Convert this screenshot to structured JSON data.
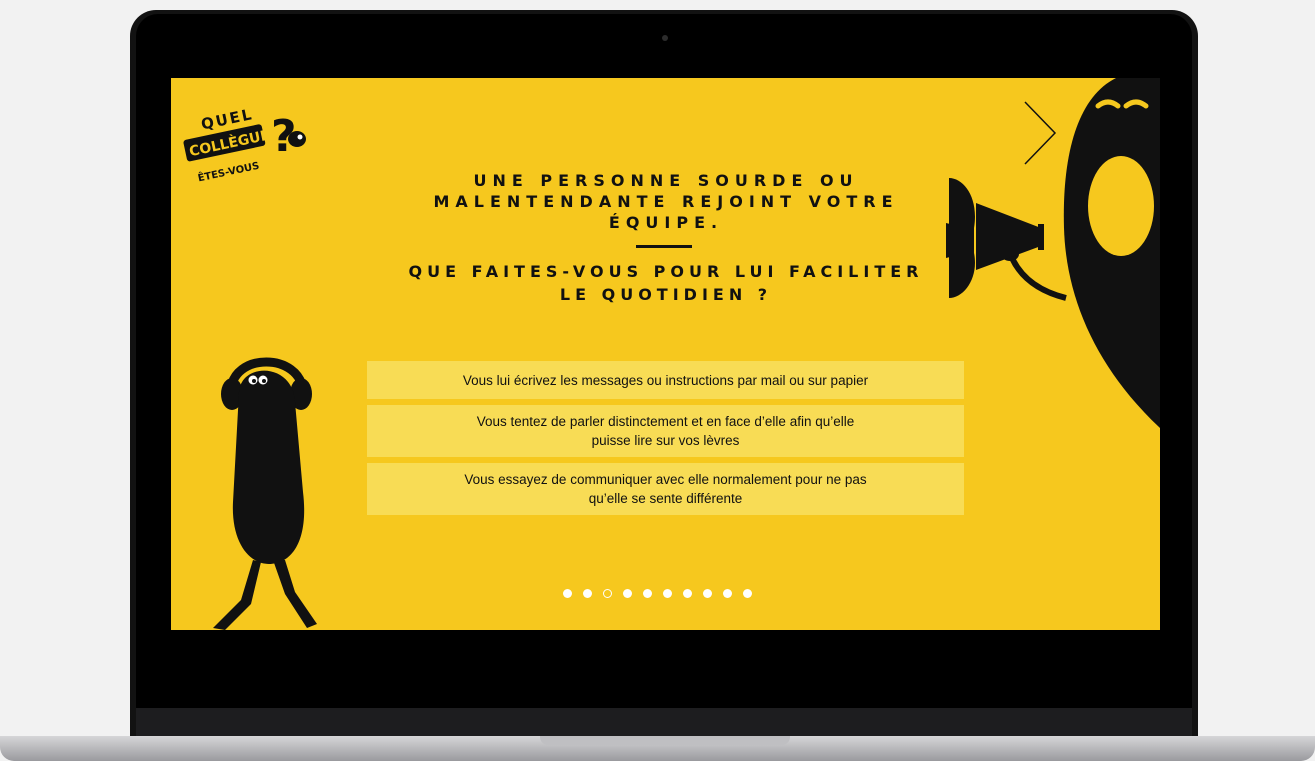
{
  "logo": {
    "line1": "QUEL",
    "line2": "COLLÈGUE",
    "line3": "ÊTES-VOUS",
    "mark": "?"
  },
  "headline": "UNE PERSONNE SOURDE OU MALENTENDANTE REJOINT VOTRE ÉQUIPE.",
  "question": "QUE FAITES-VOUS POUR LUI FACILITER LE QUOTIDIEN ?",
  "answers": [
    "Vous lui écrivez les messages ou instructions par mail ou sur papier",
    "Vous tentez de parler distinctement et en face d’elle afin qu’elle puisse lire sur vos lèvres",
    "Vous essayez de communiquer avec elle normalement pour ne pas qu’elle se sente différente"
  ],
  "pagination": {
    "total": 10,
    "current": 3
  },
  "icons": {
    "next": "chevron-right-icon"
  },
  "colors": {
    "background": "#f6c81e",
    "answer_bg": "#f8dc55",
    "ink": "#111111"
  }
}
